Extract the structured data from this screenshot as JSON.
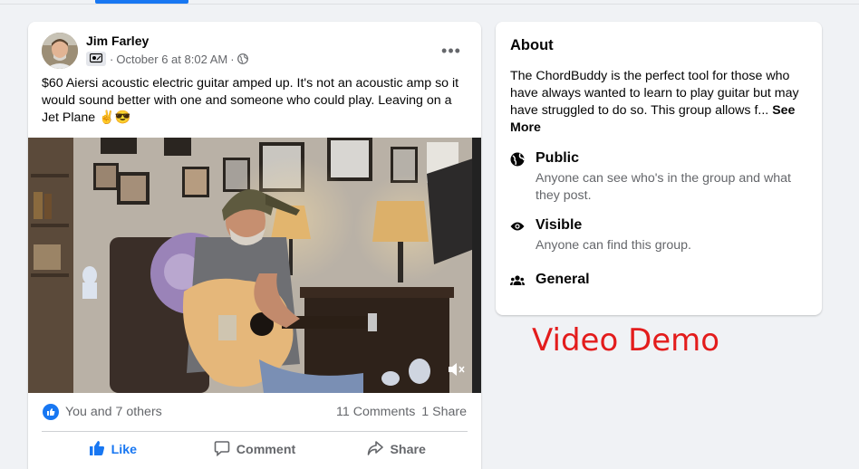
{
  "post": {
    "author": "Jim Farley",
    "date": "October 6 at 8:02 AM",
    "meta_separator": "·",
    "more_label": "•••",
    "text": "$60 Aiersi acoustic electric guitar amped up. It's not an acoustic amp so it would sound better with one and someone who could play. Leaving on a Jet Plane ✌️😎",
    "reactions_text": "You and 7 others",
    "comments_text": "11 Comments",
    "shares_text": "1 Share",
    "actions": {
      "like": "Like",
      "comment": "Comment",
      "share": "Share"
    },
    "video_muted": true
  },
  "about": {
    "title": "About",
    "description": "The ChordBuddy is the perfect tool for those who have always wanted to learn to play guitar but may have struggled to do so. This group allows f...",
    "see_more": "See More",
    "items": [
      {
        "icon": "globe-icon",
        "title": "Public",
        "subtitle": "Anyone can see who's in the group and what they post."
      },
      {
        "icon": "eye-icon",
        "title": "Visible",
        "subtitle": "Anyone can find this group."
      },
      {
        "icon": "group-icon",
        "title": "General",
        "subtitle": ""
      }
    ]
  },
  "overlay": {
    "demo_label": "Video Demo"
  },
  "colors": {
    "accent": "#1877f2",
    "demo_label": "#e31c1c",
    "secondary_text": "#65676b"
  }
}
